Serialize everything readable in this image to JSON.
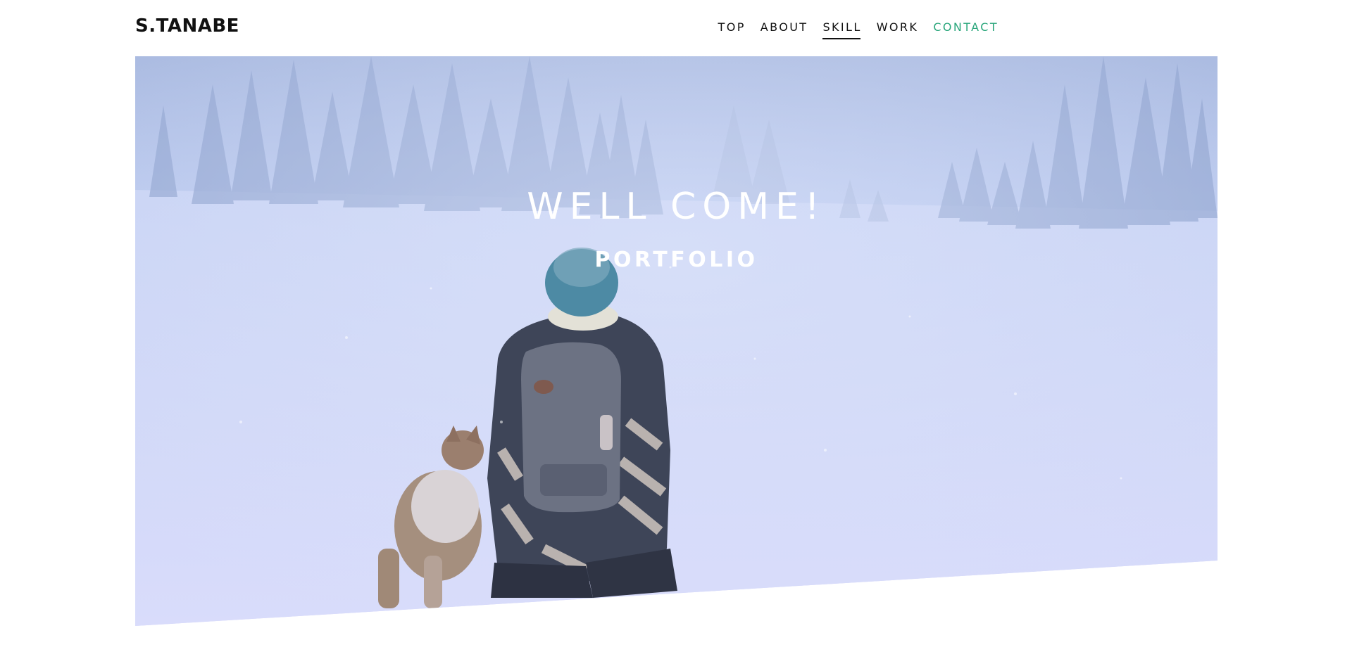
{
  "header": {
    "logo": "S.TANABE",
    "nav": [
      {
        "label": "TOP",
        "active": false
      },
      {
        "label": "ABOUT",
        "active": false
      },
      {
        "label": "SKILL",
        "active": true
      },
      {
        "label": "WORK",
        "active": false
      },
      {
        "label": "CONTACT",
        "active": false
      }
    ]
  },
  "hero": {
    "title": "WELL COME!",
    "subtitle": "PORTFOLIO"
  },
  "colors": {
    "text": "#111111",
    "contact_accent": "#2aa67b",
    "hero_tint": "#c5d1f3"
  },
  "icons": [
    "hero-snow-scene-image"
  ]
}
